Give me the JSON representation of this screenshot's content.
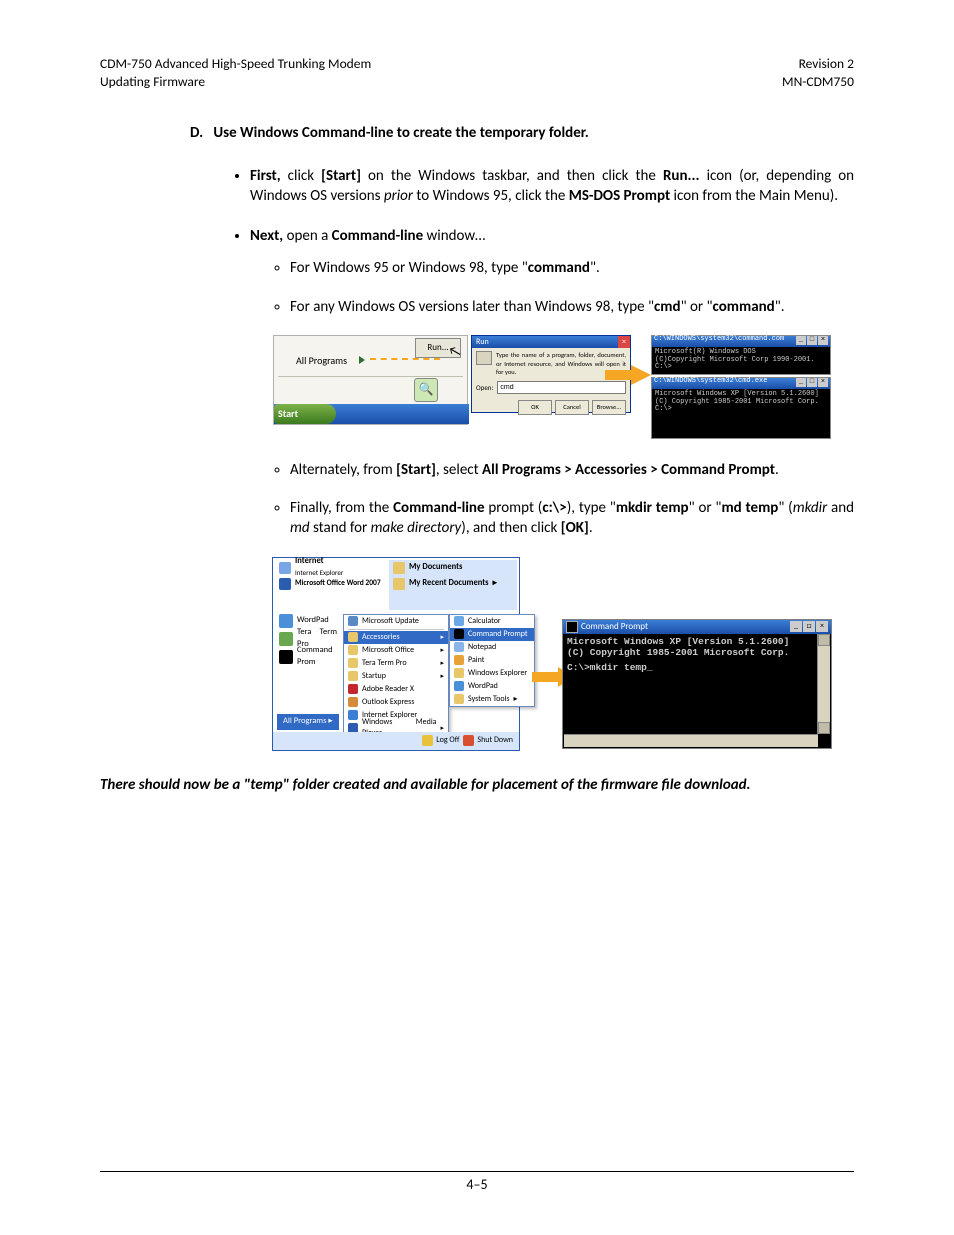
{
  "header": {
    "left_line1": "CDM-750 Advanced High-Speed Trunking Modem",
    "left_line2": "Updating Firmware",
    "right_line1": "Revision 2",
    "right_line2": "MN-CDM750"
  },
  "section": {
    "letter": "D.",
    "title": "Use Windows Command-line to create the temporary folder."
  },
  "bullet1": {
    "lead": "First,",
    "t1": " click ",
    "start": "[Start]",
    "t2": " on the Windows taskbar, and then click the ",
    "run": "Run...",
    "t3": " icon (or, depending on Windows OS versions ",
    "prior": "prior",
    "t4": " to Windows 95, click the ",
    "msdos": "MS-DOS Prompt",
    "t5": " icon from the Main Menu)."
  },
  "bullet2": {
    "lead": "Next,",
    "t1": " open a ",
    "cmdline": "Command-line",
    "t2": " window…"
  },
  "sub1": {
    "t1": "For Windows 95 or Windows 98, type \"",
    "cmd": "command",
    "t2": "\"."
  },
  "sub2": {
    "t1": "For any Windows OS versions later than Windows 98, type \"",
    "cmd": "cmd",
    "t2": "\" or \"",
    "command": "command",
    "t3": "\"."
  },
  "sub3": {
    "t1": "Alternately, from ",
    "start": "[Start]",
    "t2": ", select ",
    "path": "All Programs > Accessories > Command Prompt",
    "t3": "."
  },
  "sub4": {
    "t1": "Finally, from the ",
    "cmdline": "Command-line",
    "t2": " prompt (",
    "prompt": "c:\\>",
    "t3": "), type \"",
    "mkdir": "mkdir temp",
    "t4": "\" or \"",
    "md": "md temp",
    "t5": "\" (",
    "i1": "mkdir",
    "t6": " and ",
    "i2": "md",
    "t7": " stand for ",
    "i3": "make directory",
    "t8": "), and then click ",
    "ok": "[OK]",
    "t9": "."
  },
  "fig1": {
    "all_programs": "All Programs",
    "run_label": "Run...",
    "start_label": "Start",
    "run_title": "Run",
    "run_desc": "Type the name of a program, folder, document, or Internet resource, and Windows will open it for you.",
    "open_label": "Open:",
    "open_value": "cmd",
    "ok": "OK",
    "cancel": "Cancel",
    "browse": "Browse...",
    "cmd1_title": "C:\\WINDOWS\\system32\\command.com",
    "cmd1_line1": "Microsoft(R) Windows DOS",
    "cmd1_line2": "(C)Copyright Microsoft Corp 1990-2001.",
    "cmd1_line3": "C:\\>",
    "cmd2_title": "C:\\WINDOWS\\system32\\cmd.exe",
    "cmd2_line1": "Microsoft Windows XP [Version 5.1.2600]",
    "cmd2_line2": "(C) Copyright 1985-2001 Microsoft Corp.",
    "cmd2_line3": "C:\\>"
  },
  "fig2": {
    "internet": "Internet",
    "internet_sub": "Internet Explorer",
    "word": "Microsoft Office Word 2007",
    "mydocs": "My Documents",
    "myrecent": "My Recent Documents",
    "msupdate": "Microsoft Update",
    "accessories": "Accessories",
    "msoffice": "Microsoft Office",
    "teraterm": "Tera Term Pro",
    "startup": "Startup",
    "adobe": "Adobe Reader X",
    "outlook": "Outlook Express",
    "ie": "Internet Explorer",
    "wmp": "Windows Media Player",
    "wordpad_left": "WordPad",
    "teraterm_left": "Tera Term Pro",
    "cmdprom_left": "Command Prom",
    "allprograms": "All Programs",
    "logoff": "Log Off",
    "shutdown": "Shut Down",
    "calculator": "Calculator",
    "cmdprompt": "Command Prompt",
    "notepad": "Notepad",
    "paint": "Paint",
    "winexpl": "Windows Explorer",
    "wordpad": "WordPad",
    "systools": "System Tools",
    "cmd_title": "Command Prompt",
    "cmd_line1": "Microsoft Windows XP [Version 5.1.2600]",
    "cmd_line2": "(C) Copyright 1985-2001 Microsoft Corp.",
    "cmd_line3": "C:\\>mkdir temp_"
  },
  "conclusion": "There should now be a \"temp\" folder created and available for placement of the firmware file download.",
  "page_number": "4–5"
}
